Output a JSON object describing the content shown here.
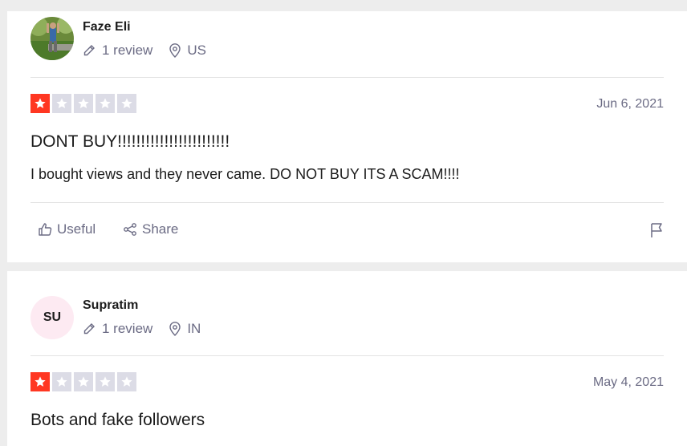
{
  "reviews": [
    {
      "reviewer_name": "Faze Eli",
      "review_count": "1 review",
      "country": "US",
      "rating": 1,
      "date": "Jun 6, 2021",
      "title": "DONT BUY!!!!!!!!!!!!!!!!!!!!!!!!",
      "body": "I bought views and they never came. DO NOT BUY ITS A SCAM!!!!",
      "useful_label": "Useful",
      "share_label": "Share"
    },
    {
      "reviewer_name": "Supratim",
      "avatar_initials": "SU",
      "review_count": "1 review",
      "country": "IN",
      "rating": 1,
      "date": "May 4, 2021",
      "title": "Bots and fake followers"
    }
  ],
  "colors": {
    "star_on": "#ff3722",
    "star_off": "#dcdce6",
    "muted_text": "#6b6b84"
  },
  "icons": [
    "pencil-icon",
    "location-pin-icon",
    "star-icon",
    "thumbs-up-icon",
    "share-icon",
    "flag-icon"
  ]
}
